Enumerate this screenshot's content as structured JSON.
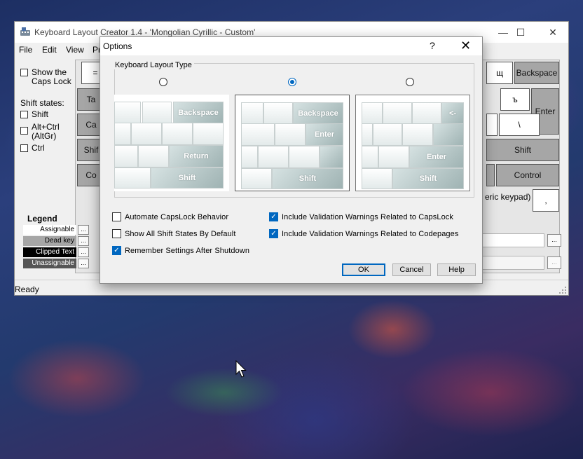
{
  "main_window": {
    "title": "Keyboard Layout Creator 1.4 - 'Mongolian Cyrillic - Custom'",
    "controls": {
      "minimize": "—",
      "maximize": "☐",
      "close": "✕"
    },
    "menu": [
      "File",
      "Edit",
      "View",
      "Pr"
    ],
    "left_panel": {
      "caps_lock_label": "Show the Caps Lock",
      "shift_states_label": "Shift states:",
      "shift_label": "Shift",
      "altctrl_label": "Alt+Ctrl (AltGr)",
      "ctrl_label": "Ctrl"
    },
    "keys": {
      "equals": "=",
      "tab_partial": "Ta",
      "caps_partial": "Ca",
      "shift_partial": "Shif",
      "ctrl_partial": "Co",
      "shcha": "щ",
      "backspace": "Backspace",
      "hard_sign": "ъ",
      "enter": "Enter",
      "backslash": "\\",
      "shift_right": "Shift",
      "control_right": "Control",
      "comma": ","
    },
    "numeric_keypad_partial": "eric keypad)",
    "legend": {
      "title": "Legend",
      "items": [
        "Assignable",
        "Dead key",
        "Clipped Text",
        "Unassignable"
      ],
      "button_label": "..."
    },
    "field_button_label": "...",
    "status": "Ready"
  },
  "dialog": {
    "title": "Options",
    "help_glyph": "?",
    "close_glyph": "✕",
    "group_label": "Keyboard Layout Type",
    "layout_types": [
      {
        "selected": false,
        "keys": [
          "Backspace",
          "Return",
          "Shift"
        ]
      },
      {
        "selected": true,
        "keys": [
          "Backspace",
          "Enter",
          "Shift"
        ]
      },
      {
        "selected": false,
        "keys": [
          "<-",
          "Enter",
          "Shift"
        ]
      }
    ],
    "options_left": [
      {
        "label": "Automate CapsLock Behavior",
        "checked": false
      },
      {
        "label": "Show All Shift States By Default",
        "checked": false
      },
      {
        "label": "Remember Settings After Shutdown",
        "checked": true
      }
    ],
    "options_right": [
      {
        "label": "Include Validation Warnings Related to CapsLock",
        "checked": true
      },
      {
        "label": "Include Validation Warnings Related to Codepages",
        "checked": true
      }
    ],
    "buttons": {
      "ok": "OK",
      "cancel": "Cancel",
      "help": "Help"
    }
  }
}
